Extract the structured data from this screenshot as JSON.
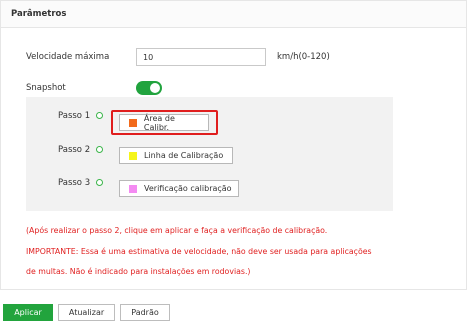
{
  "panel": {
    "title": "Parâmetros"
  },
  "speed": {
    "label": "Velocidade máxima",
    "value": "10",
    "unit": "km/h(0-120)"
  },
  "snapshot": {
    "label": "Snapshot",
    "enabled": true
  },
  "steps": [
    {
      "label": "Passo 1",
      "button": "Área de Calibr.",
      "swatch_color": "#f26a1b",
      "highlighted": true
    },
    {
      "label": "Passo 2",
      "button": "Linha de Calibração",
      "swatch_color": "#f5f51a",
      "highlighted": false
    },
    {
      "label": "Passo 3",
      "button": "Verificação calibração",
      "swatch_color": "#f48af2",
      "highlighted": false
    }
  ],
  "notes": [
    "(Após realizar o passo 2, clique em aplicar e faça a verificação de calibração.",
    "IMPORTANTE: Essa é uma estimativa de velocidade, não deve ser usada para aplicações",
    "de multas. Não é indicado para instalações em rodovias.)"
  ],
  "actions": {
    "apply": "Aplicar",
    "refresh": "Atualizar",
    "default": "Padrão"
  },
  "colors": {
    "accent": "#22a43d",
    "warning": "#e02020",
    "highlight": "#e01e1e"
  }
}
